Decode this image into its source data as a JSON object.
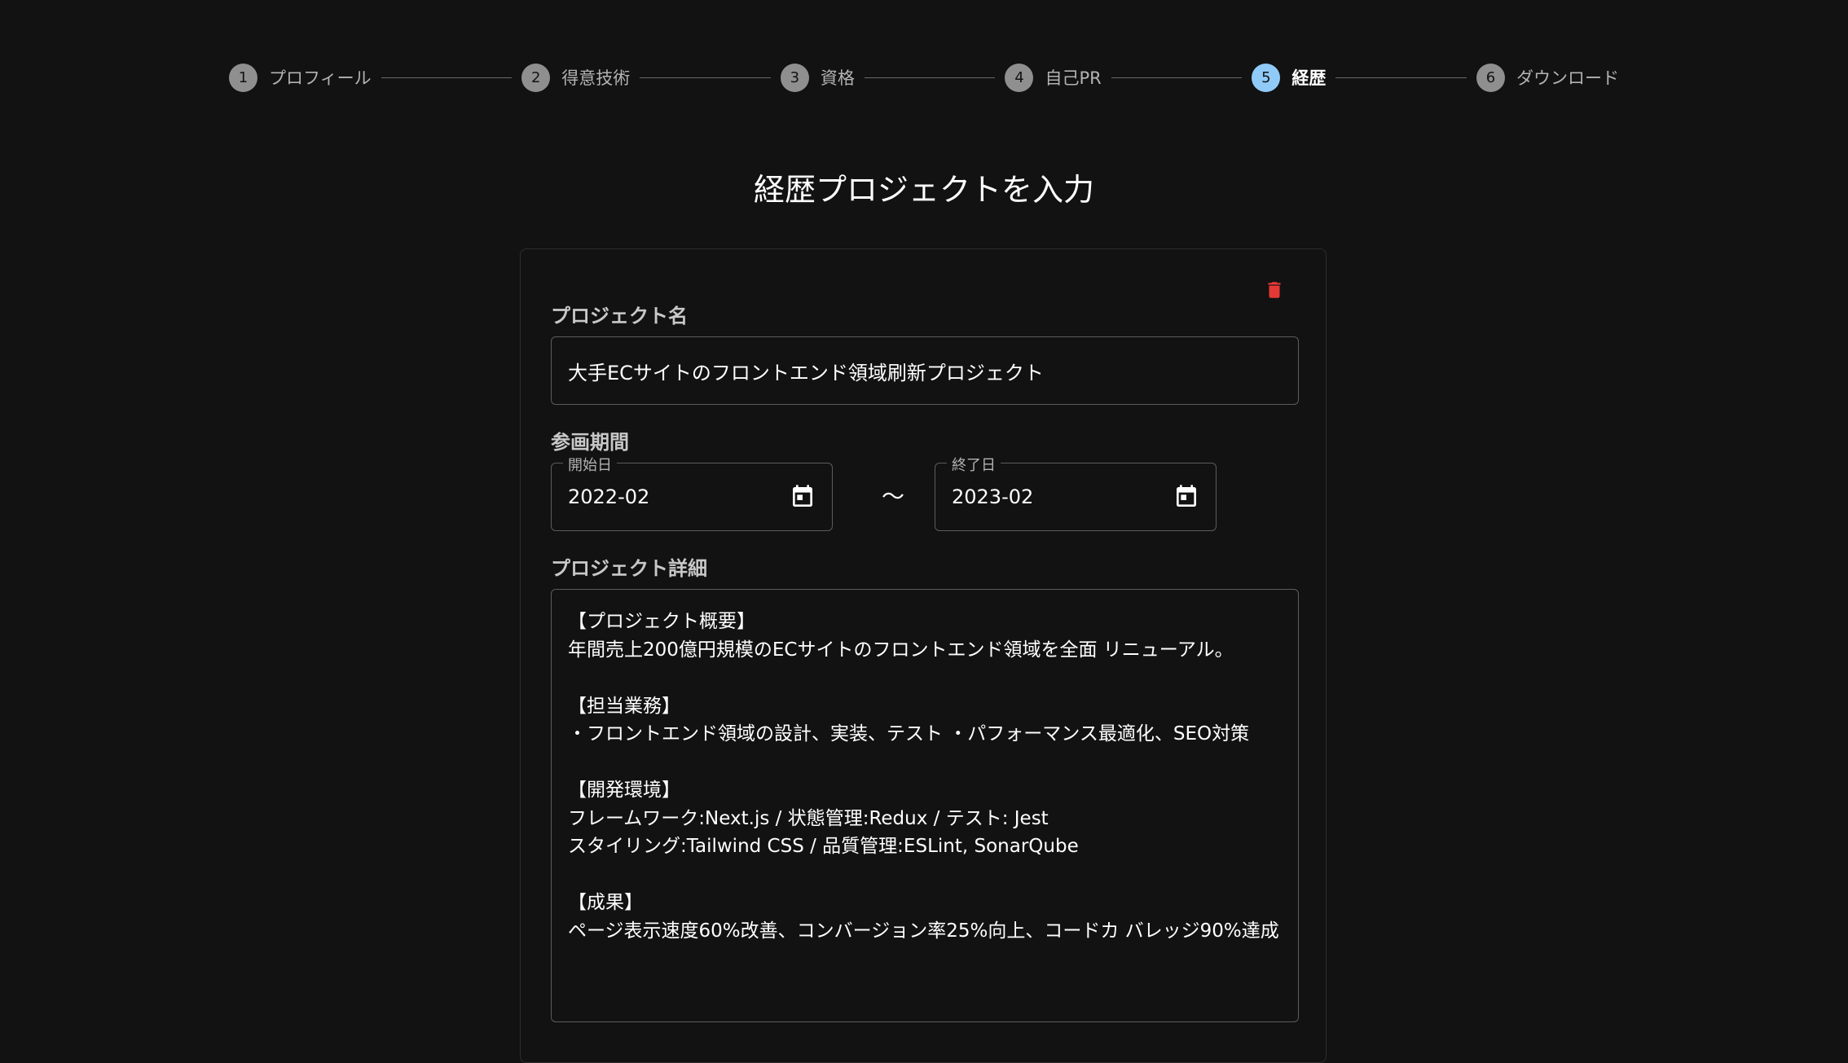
{
  "stepper": {
    "steps": [
      {
        "number": "1",
        "label": "プロフィール"
      },
      {
        "number": "2",
        "label": "得意技術"
      },
      {
        "number": "3",
        "label": "資格"
      },
      {
        "number": "4",
        "label": "自己PR"
      },
      {
        "number": "5",
        "label": "経歴"
      },
      {
        "number": "6",
        "label": "ダウンロード"
      }
    ],
    "active_step": 5
  },
  "page": {
    "title": "経歴プロジェクトを入力"
  },
  "project": {
    "name_label": "プロジェクト名",
    "name_value": "大手ECサイトのフロントエンド領域刷新プロジェクト",
    "period_label": "参画期間",
    "start_label": "開始日",
    "start_value": "2022-02",
    "separator": "〜",
    "end_label": "終了日",
    "end_value": "2023-02",
    "detail_label": "プロジェクト詳細",
    "detail_value": "【プロジェクト概要】\n年間売上200億円規模のECサイトのフロントエンド領域を全面 リニューアル。\n\n【担当業務】\n・フロントエンド領域の設計、実装、テスト ・パフォーマンス最適化、SEO対策\n\n【開発環境】\nフレームワーク:Next.js / 状態管理:Redux / テスト: Jest\nスタイリング:Tailwind CSS / 品質管理:ESLint, SonarQube\n\n【成果】\nページ表示速度60%改善、コンバージョン率25%向上、コードカ バレッジ90%達成"
  },
  "icons": {
    "delete": "trash-icon",
    "calendar": "calendar-icon"
  },
  "colors": {
    "background": "#121212",
    "active_step": "#90caf9",
    "inactive_step": "#8f8f8f",
    "delete": "#e53935"
  }
}
